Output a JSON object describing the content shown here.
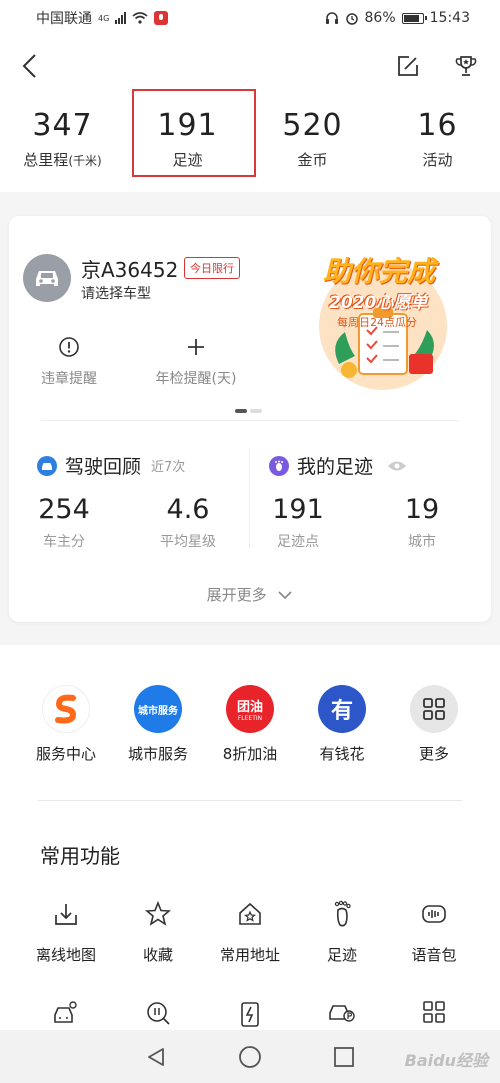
{
  "status_bar": {
    "carrier": "中国联通",
    "network": "4G",
    "battery": "86%",
    "time": "15:43"
  },
  "stats": [
    {
      "value": "347",
      "label": "总里程",
      "unit": "(千米)"
    },
    {
      "value": "191",
      "label": "足迹",
      "unit": ""
    },
    {
      "value": "520",
      "label": "金币",
      "unit": ""
    },
    {
      "value": "16",
      "label": "活动",
      "unit": ""
    }
  ],
  "vehicle": {
    "plate": "京A36452",
    "badge": "今日限行",
    "subtitle": "请选择车型"
  },
  "promo": {
    "title": "助你完成",
    "subtitle": "2020心愿单",
    "note": "每周日24点瓜分"
  },
  "quick_actions": [
    {
      "label": "违章提醒",
      "icon": "alert-circle-icon"
    },
    {
      "label": "年检提醒(天)",
      "icon": "plus-icon"
    }
  ],
  "driving_review": {
    "title": "驾驶回顾",
    "subtitle": "近7次",
    "metrics": [
      {
        "value": "254",
        "label": "车主分"
      },
      {
        "value": "4.6",
        "label": "平均星级"
      }
    ]
  },
  "my_footprint": {
    "title": "我的足迹",
    "metrics": [
      {
        "value": "191",
        "label": "足迹点"
      },
      {
        "value": "19",
        "label": "城市"
      }
    ]
  },
  "expand_label": "展开更多",
  "services": [
    {
      "label": "服务中心",
      "icon_text": "",
      "color": "#ff6a1a"
    },
    {
      "label": "城市服务",
      "icon_text": "城市服务",
      "color": "#1f7be8"
    },
    {
      "label": "8折加油",
      "icon_text": "团油",
      "icon_sub": "FLEETIN",
      "color": "#e8232a"
    },
    {
      "label": "有钱花",
      "icon_text": "有",
      "color": "#2d56c9"
    },
    {
      "label": "更多",
      "icon_text": "",
      "color": "#e6e6e6"
    }
  ],
  "common_functions": {
    "title": "常用功能",
    "items": [
      {
        "label": "离线地图",
        "icon": "offline-map-icon"
      },
      {
        "label": "收藏",
        "icon": "star-icon"
      },
      {
        "label": "常用地址",
        "icon": "home-star-icon"
      },
      {
        "label": "足迹",
        "icon": "footprint-icon"
      },
      {
        "label": "语音包",
        "icon": "voice-pack-icon"
      }
    ]
  },
  "watermark": "Baidu经验"
}
